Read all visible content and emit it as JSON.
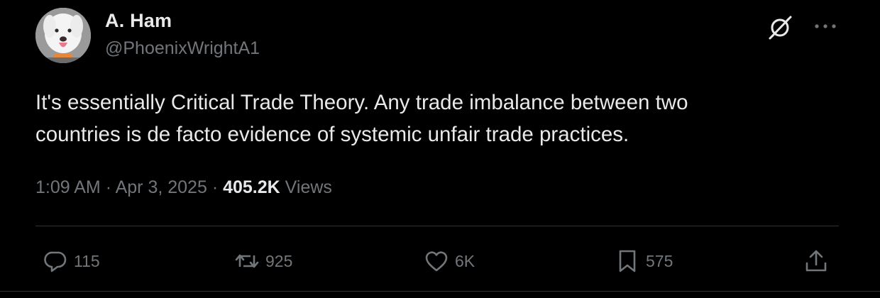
{
  "author": {
    "display_name": "A. Ham",
    "handle": "@PhoenixWrightA1",
    "avatar_icon": "dog-avatar"
  },
  "header_icons": {
    "grok": "grok-icon",
    "more": "more-icon"
  },
  "tweet": {
    "text": "It's essentially Critical Trade Theory. Any trade imbalance between two\ncountries is de facto evidence of systemic unfair trade practices."
  },
  "meta": {
    "time": "1:09 AM",
    "separator": "·",
    "date": "Apr 3, 2025",
    "views_count": "405.2K",
    "views_label": "Views"
  },
  "actions": {
    "reply": {
      "count": "115",
      "icon": "reply-icon"
    },
    "retweet": {
      "count": "925",
      "icon": "retweet-icon"
    },
    "like": {
      "count": "6K",
      "icon": "heart-icon"
    },
    "bookmark": {
      "count": "575",
      "icon": "bookmark-icon"
    },
    "share": {
      "icon": "share-icon"
    }
  },
  "colors": {
    "background": "#000000",
    "primary_text": "#e7e9ea",
    "secondary_text": "#71767b",
    "divider": "#2f3336"
  }
}
